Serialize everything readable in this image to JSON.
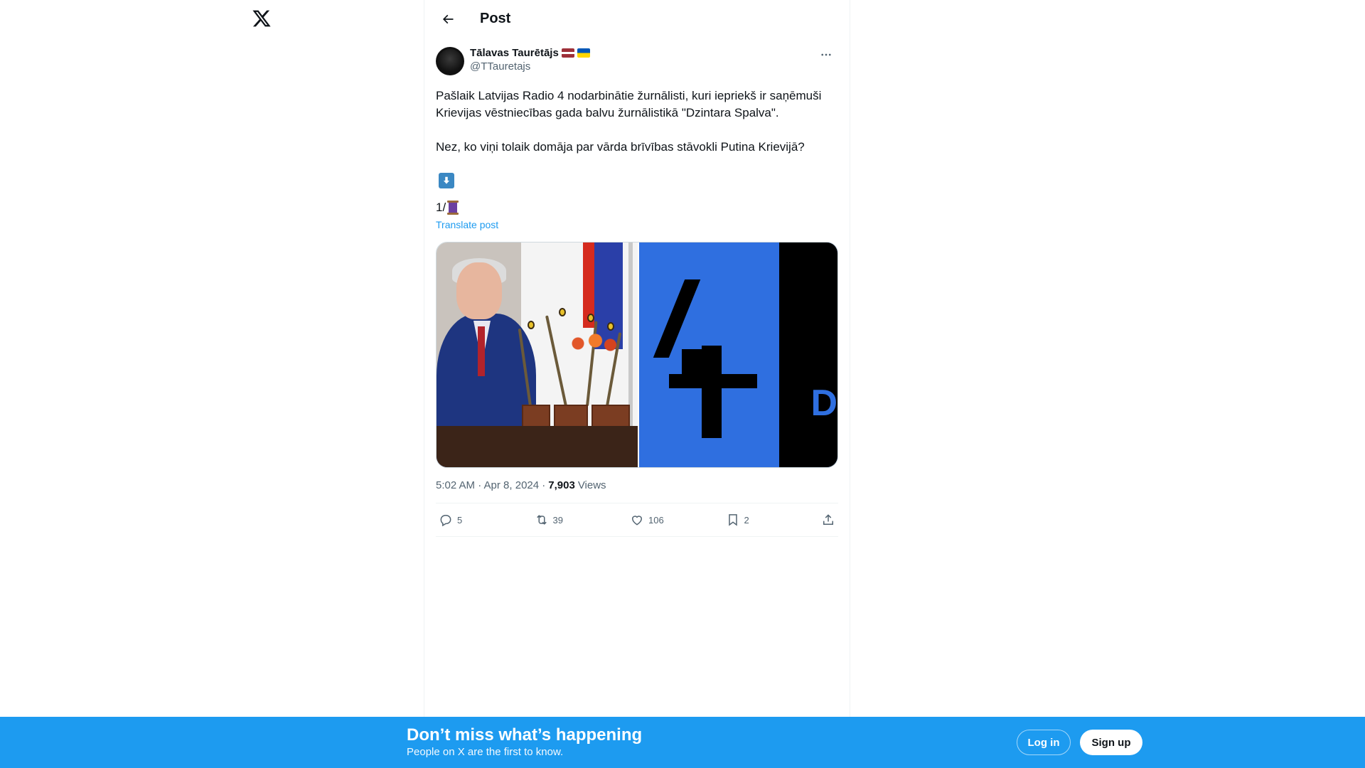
{
  "header": {
    "title": "Post"
  },
  "author": {
    "display_name": "Tālavas Taurētājs",
    "handle": "@TTauretajs",
    "flags": [
      "latvia-flag-icon",
      "ukraine-flag-icon"
    ],
    "avatar_text": "🦬"
  },
  "post": {
    "paragraph_1": "Pašlaik Latvijas Radio 4 nodarbinātie žurnālisti, kuri iepriekš ir saņēmuši Krievijas vēstniecības gada balvu žurnālistikā \"Dzintara Spalva\".",
    "paragraph_2": "Nez, ko viņi tolaik domāja par vārda brīvības stāvokli Putina Krievijā?",
    "thread_marker": "1/",
    "translate_label": "Translate post",
    "timestamp": "5:02 AM · Apr 8, 2024 ·",
    "views_count": "7,903",
    "views_label": "Views"
  },
  "media": {
    "right_partial_letter": "D"
  },
  "actions": {
    "replies": "5",
    "reposts": "39",
    "likes": "106",
    "bookmarks": "2"
  },
  "banner": {
    "title": "Don’t miss what’s happening",
    "subtitle": "People on X are the first to know.",
    "login_label": "Log in",
    "signup_label": "Sign up"
  },
  "colors": {
    "accent": "#1d9bf0",
    "text": "#0f1419",
    "muted": "#536471"
  }
}
